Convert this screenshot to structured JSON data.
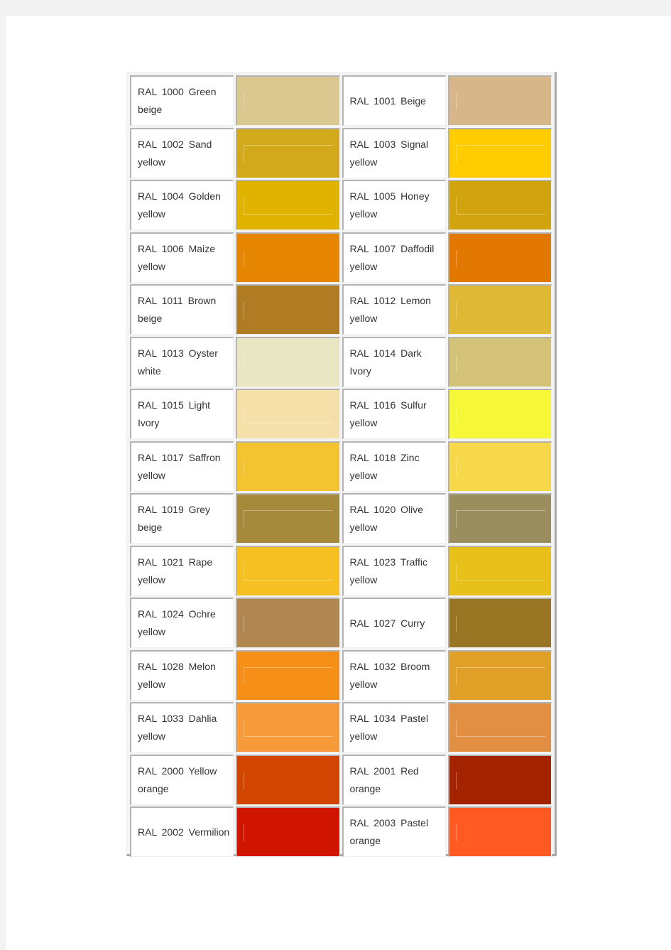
{
  "table": {
    "rows": [
      [
        {
          "label": "RAL 1000 Green beige",
          "color": "#d9c890",
          "mark": "line"
        },
        {
          "label": "RAL 1001 Beige",
          "color": "#d7b78a",
          "mark": "line"
        }
      ],
      [
        {
          "label": "RAL 1002 Sand yellow",
          "color": "#d1a91a",
          "mark": "bracket"
        },
        {
          "label": "RAL 1003 Signal yellow",
          "color": "#ffcc00",
          "mark": "bracket"
        }
      ],
      [
        {
          "label": "RAL 1004 Golden yellow",
          "color": "#dfb300",
          "mark": "bracket-bottom"
        },
        {
          "label": "RAL 1005 Honey yellow",
          "color": "#d1a30e",
          "mark": "bracket-bottom"
        }
      ],
      [
        {
          "label": "RAL 1006 Maize yellow",
          "color": "#e68600",
          "mark": "line"
        },
        {
          "label": "RAL 1007 Daffodil yellow",
          "color": "#e37800",
          "mark": "line"
        }
      ],
      [
        {
          "label": "RAL 1011 Brown beige",
          "color": "#af7c24",
          "mark": "line"
        },
        {
          "label": "RAL 1012 Lemon yellow",
          "color": "#dfb835",
          "mark": "line"
        }
      ],
      [
        {
          "label": "RAL 1013 Oyster white",
          "color": "#e9e6c4",
          "mark": "line"
        },
        {
          "label": "RAL 1014 Dark Ivory",
          "color": "#d3c278",
          "mark": "line"
        }
      ],
      [
        {
          "label": "RAL 1015 Light Ivory",
          "color": "#f4e0a8",
          "mark": "bracket-bottom"
        },
        {
          "label": "RAL 1016 Sulfur yellow",
          "color": "#f6f837",
          "mark": "line"
        }
      ],
      [
        {
          "label": "RAL 1017 Saffron yellow",
          "color": "#f3c42f",
          "mark": "line"
        },
        {
          "label": "RAL 1018 Zinc yellow",
          "color": "#f7d84a",
          "mark": "line"
        }
      ],
      [
        {
          "label": "RAL 1019 Grey beige",
          "color": "#a58a3b",
          "mark": "bracket"
        },
        {
          "label": "RAL 1020 Olive yellow",
          "color": "#9a8e5e",
          "mark": "bracket"
        }
      ],
      [
        {
          "label": "RAL 1021 Rape yellow",
          "color": "#f6c022",
          "mark": "bracket-bottom"
        },
        {
          "label": "RAL 1023 Traffic yellow",
          "color": "#e7c01a",
          "mark": "bracket-bottom"
        }
      ],
      [
        {
          "label": "RAL 1024 Ochre yellow",
          "color": "#b18751",
          "mark": "line"
        },
        {
          "label": "RAL 1027 Curry",
          "color": "#977522",
          "mark": "line"
        }
      ],
      [
        {
          "label": "RAL 1028 Melon yellow",
          "color": "#f68f17",
          "mark": "bracket"
        },
        {
          "label": "RAL 1032 Broom yellow",
          "color": "#e09f26",
          "mark": "bracket"
        }
      ],
      [
        {
          "label": "RAL 1033 Dahlia yellow",
          "color": "#f69a3a",
          "mark": "bracket-bottom"
        },
        {
          "label": "RAL 1034 Pastel yellow",
          "color": "#e28f43",
          "mark": "bracket-bottom"
        }
      ],
      [
        {
          "label": "RAL 2000 Yellow orange",
          "color": "#d24500",
          "mark": "line"
        },
        {
          "label": "RAL 2001 Red orange",
          "color": "#a32200",
          "mark": "line"
        }
      ],
      [
        {
          "label": "RAL 2002 Vermilion",
          "color": "#cf1500",
          "mark": "line"
        },
        {
          "label": "RAL 2003 Pastel orange",
          "color": "#fe5a21",
          "mark": "line"
        }
      ]
    ]
  }
}
